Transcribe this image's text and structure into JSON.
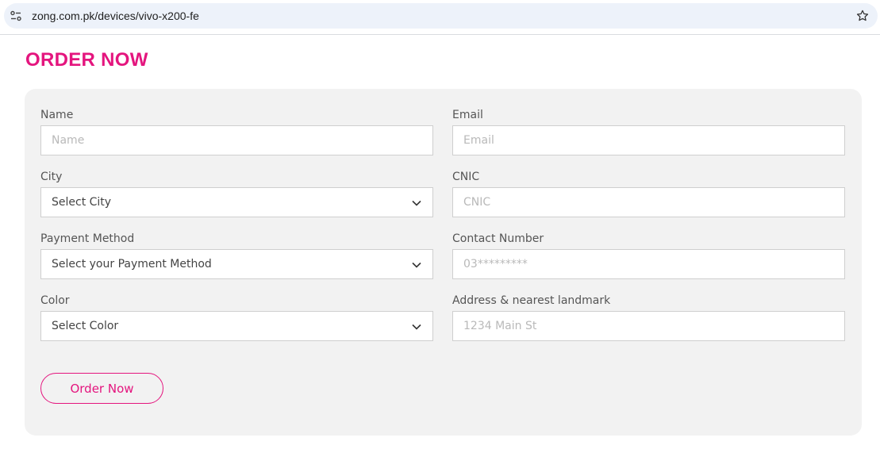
{
  "browser": {
    "url": "zong.com.pk/devices/vivo-x200-fe",
    "site_info_icon": "tune-icon",
    "bookmark_icon": "star-icon"
  },
  "page": {
    "title": "ORDER NOW",
    "accent_color": "#e4157e"
  },
  "form": {
    "name": {
      "label": "Name",
      "placeholder": "Name"
    },
    "email": {
      "label": "Email",
      "placeholder": "Email"
    },
    "city": {
      "label": "City",
      "selected": "Select City"
    },
    "cnic": {
      "label": "CNIC",
      "placeholder": "CNIC"
    },
    "payment": {
      "label": "Payment Method",
      "selected": "Select your Payment Method"
    },
    "contact": {
      "label": "Contact Number",
      "placeholder": "03*********"
    },
    "color": {
      "label": "Color",
      "selected": "Select Color"
    },
    "address": {
      "label": "Address & nearest landmark",
      "placeholder": "1234 Main St"
    },
    "submit_label": "Order Now"
  }
}
